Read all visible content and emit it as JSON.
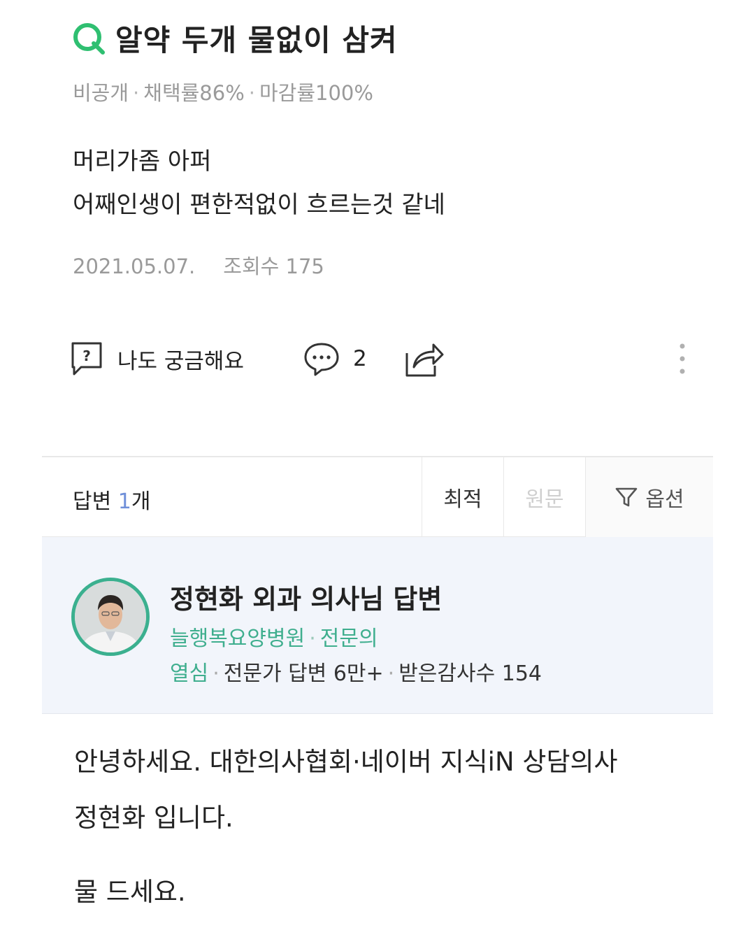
{
  "question": {
    "title": "알약 두개 물없이 삼켜",
    "visibility": "비공개",
    "adoption_rate": "채택률86%",
    "close_rate": "마감률100%",
    "body_lines": [
      "머리가좀 아퍼",
      "어째인생이 편한적없이 흐르는것 같네"
    ],
    "date": "2021.05.07.",
    "views": "조회수 175"
  },
  "actions": {
    "curious_label": "나도 궁금해요",
    "comment_count": "2"
  },
  "answer_bar": {
    "label": "답변",
    "count": "1",
    "unit": "개",
    "sort_best": "최적",
    "sort_original": "원문",
    "options": "옵션"
  },
  "expert": {
    "name": "정현화 외과 의사님 답변",
    "hospital": "늘행복요양병원",
    "role": "전문의",
    "badge": "열심",
    "answers": "전문가 답변 6만+",
    "thanks": "받은감사수 154"
  },
  "answer": {
    "line1": "안녕하세요. 대한의사협회·네이버 지식iN 상담의사",
    "line2": "정현화 입니다.",
    "line3": "물 드세요."
  },
  "colors": {
    "brand_green": "#3fae8e",
    "q_icon_green": "#2fbf71",
    "count_blue": "#6f8fd9",
    "expert_bg": "#f2f5fb"
  },
  "icons": [
    "question-mark-icon",
    "speech-bubble-icon",
    "share-icon",
    "more-vertical-icon",
    "filter-icon"
  ]
}
